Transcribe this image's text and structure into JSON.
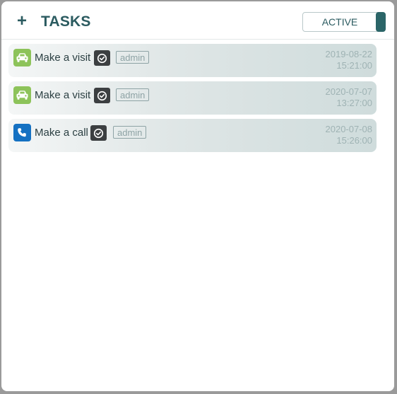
{
  "header": {
    "add_symbol": "+",
    "title": "TASKS",
    "filter_toggle": {
      "label": "ACTIVE"
    }
  },
  "colors": {
    "visit_icon_bg": "#8dc35a",
    "call_icon_bg": "#1571c2",
    "status_icon_bg": "#3c3f41",
    "accent": "#2b6568"
  },
  "tasks": [
    {
      "type_icon": "car-icon",
      "name": "Make a visit",
      "status_icon": "check-circle-icon",
      "owner": "admin",
      "date": "2019-08-22",
      "time": "15:21:00"
    },
    {
      "type_icon": "car-icon",
      "name": "Make a visit",
      "status_icon": "check-circle-icon",
      "owner": "admin",
      "date": "2020-07-07",
      "time": "13:27:00"
    },
    {
      "type_icon": "phone-icon",
      "name": "Make a call",
      "status_icon": "check-circle-icon",
      "owner": "admin",
      "date": "2020-07-08",
      "time": "15:26:00"
    }
  ]
}
